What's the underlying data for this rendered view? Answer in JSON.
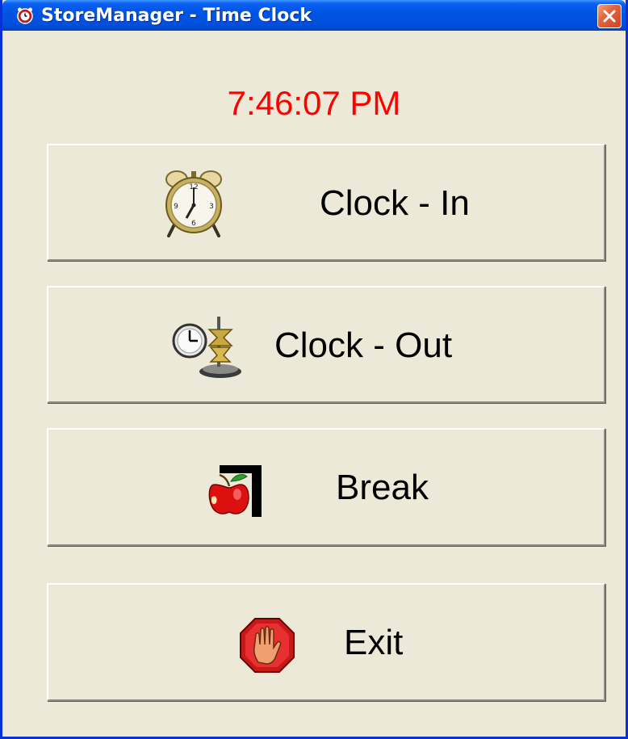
{
  "window": {
    "title": "StoreManager - Time Clock",
    "title_icon": "alarm-clock-icon",
    "close_icon": "close-icon"
  },
  "clock": {
    "time": "7:46:07 PM",
    "color": "#ff0000"
  },
  "buttons": {
    "clock_in": {
      "label": "Clock - In",
      "icon": "alarm-clock-icon"
    },
    "clock_out": {
      "label": "Clock - Out",
      "icon": "clock-punch-icon"
    },
    "break": {
      "label": "Break",
      "icon": "apple-break-icon"
    },
    "exit": {
      "label": "Exit",
      "icon": "stop-hand-icon"
    }
  },
  "colors": {
    "titlebar": "#0054e3",
    "window_bg": "#ece9d8",
    "time_text": "#ff0000"
  }
}
